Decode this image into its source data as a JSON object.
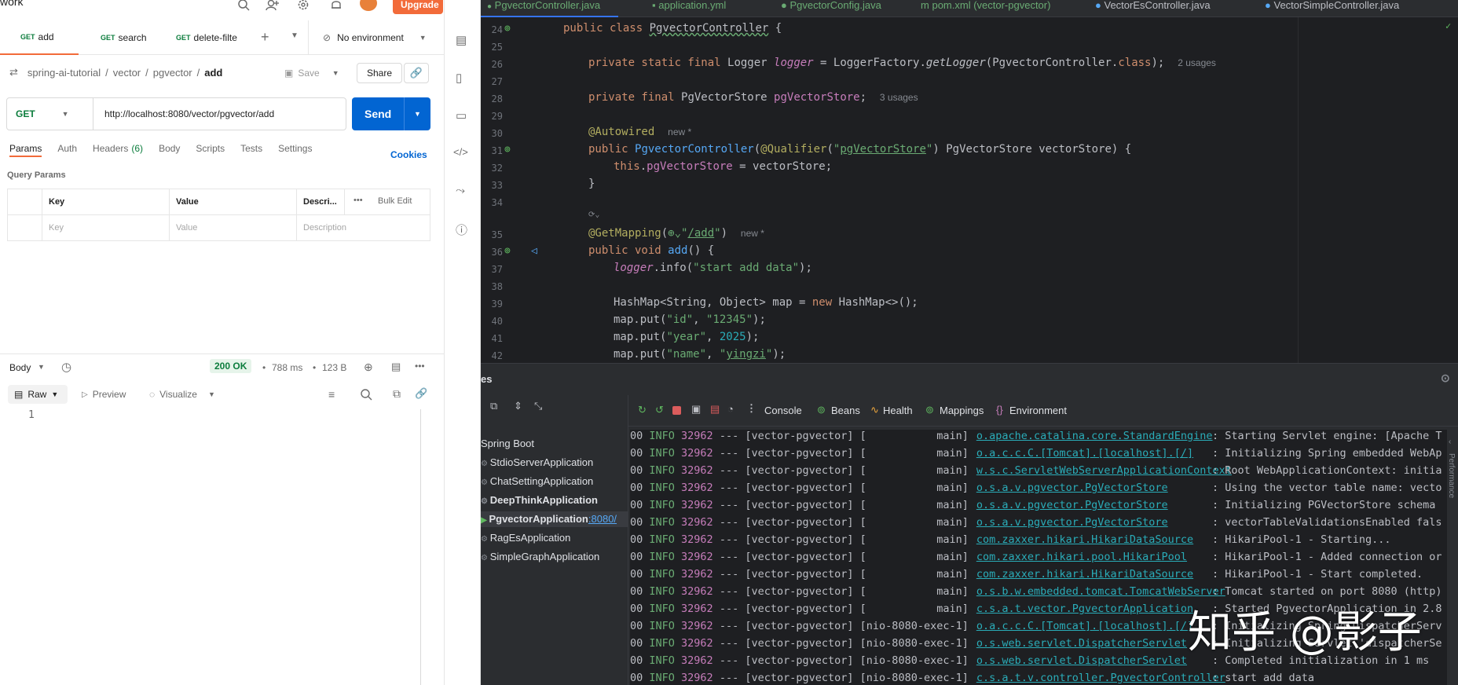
{
  "postman": {
    "workspace_label": "work",
    "upgrade_label": "Upgrade",
    "tabs": [
      {
        "method": "GET",
        "label": "add"
      },
      {
        "method": "GET",
        "label": "search"
      },
      {
        "method": "GET",
        "label": "delete-filte"
      }
    ],
    "environment": "No environment",
    "breadcrumb": [
      "spring-ai-tutorial",
      "vector",
      "pgvector",
      "add"
    ],
    "save_label": "Save",
    "share_label": "Share",
    "request": {
      "method": "GET",
      "url": "http://localhost:8080/vector/pgvector/add",
      "send_label": "Send"
    },
    "subtabs": [
      "Params",
      "Auth",
      "Headers",
      "(6)",
      "Body",
      "Scripts",
      "Tests",
      "Settings"
    ],
    "cookies_label": "Cookies",
    "query_params_label": "Query Params",
    "table_headers": [
      "Key",
      "Value",
      "Descri...",
      "Bulk Edit"
    ],
    "table_placeholder": [
      "Key",
      "Value",
      "Description"
    ],
    "response": {
      "body_label": "Body",
      "status": "200 OK",
      "time": "788 ms",
      "size": "123 B",
      "raw_label": "Raw",
      "preview_label": "Preview",
      "visualize_label": "Visualize",
      "line_number": "1"
    }
  },
  "ide": {
    "file_tabs": [
      "PgvectorController.java",
      "application.yml",
      "PgvectorConfig.java",
      "pom.xml (vector-pgvector)",
      "VectorEsController.java",
      "VectorSimpleController.java"
    ],
    "line_numbers": [
      "24",
      "25",
      "26",
      "27",
      "28",
      "29",
      "30",
      "31",
      "32",
      "33",
      "34",
      "",
      "35",
      "36",
      "37",
      "38",
      "39",
      "40",
      "41",
      "42"
    ],
    "hints": {
      "usages_2": "2 usages",
      "usages_3": "3 usages",
      "new": "new *"
    },
    "services": {
      "title": "es",
      "root": "Spring Boot",
      "apps": [
        "StdioServerApplication",
        "ChatSettingApplication",
        "DeepThinkApplication",
        "PgvectorApplication",
        "RagEsApplication",
        "SimpleGraphApplication"
      ],
      "port_label": ":8080/",
      "tabs": [
        "Console",
        "Beans",
        "Health",
        "Mappings",
        "Environment"
      ],
      "side_label": "Performance"
    },
    "log_rows": [
      {
        "level": "INFO",
        "pid": "32962",
        "sep": "---",
        "app": "[vector-pgvector]",
        "thread": "[           main]",
        "logger": "o.apache.catalina.core.StandardEngine",
        "msg": ": Starting Servlet engine: [Apache T"
      },
      {
        "level": "INFO",
        "pid": "32962",
        "sep": "---",
        "app": "[vector-pgvector]",
        "thread": "[           main]",
        "logger": "o.a.c.c.C.[Tomcat].[localhost].[/]",
        "msg": ": Initializing Spring embedded WebAp"
      },
      {
        "level": "INFO",
        "pid": "32962",
        "sep": "---",
        "app": "[vector-pgvector]",
        "thread": "[           main]",
        "logger": "w.s.c.ServletWebServerApplicationContext",
        "msg": ": Root WebApplicationContext: initia"
      },
      {
        "level": "INFO",
        "pid": "32962",
        "sep": "---",
        "app": "[vector-pgvector]",
        "thread": "[           main]",
        "logger": "o.s.a.v.pgvector.PgVectorStore",
        "msg": ": Using the vector table name: vecto"
      },
      {
        "level": "INFO",
        "pid": "32962",
        "sep": "---",
        "app": "[vector-pgvector]",
        "thread": "[           main]",
        "logger": "o.s.a.v.pgvector.PgVectorStore",
        "msg": ": Initializing PGVectorStore schema"
      },
      {
        "level": "INFO",
        "pid": "32962",
        "sep": "---",
        "app": "[vector-pgvector]",
        "thread": "[           main]",
        "logger": "o.s.a.v.pgvector.PgVectorStore",
        "msg": ": vectorTableValidationsEnabled fals"
      },
      {
        "level": "INFO",
        "pid": "32962",
        "sep": "---",
        "app": "[vector-pgvector]",
        "thread": "[           main]",
        "logger": "com.zaxxer.hikari.HikariDataSource",
        "msg": ": HikariPool-1 - Starting..."
      },
      {
        "level": "INFO",
        "pid": "32962",
        "sep": "---",
        "app": "[vector-pgvector]",
        "thread": "[           main]",
        "logger": "com.zaxxer.hikari.pool.HikariPool",
        "msg": ": HikariPool-1 - Added connection or"
      },
      {
        "level": "INFO",
        "pid": "32962",
        "sep": "---",
        "app": "[vector-pgvector]",
        "thread": "[           main]",
        "logger": "com.zaxxer.hikari.HikariDataSource",
        "msg": ": HikariPool-1 - Start completed."
      },
      {
        "level": "INFO",
        "pid": "32962",
        "sep": "---",
        "app": "[vector-pgvector]",
        "thread": "[           main]",
        "logger": "o.s.b.w.embedded.tomcat.TomcatWebServer",
        "msg": ": Tomcat started on port 8080 (http)"
      },
      {
        "level": "INFO",
        "pid": "32962",
        "sep": "---",
        "app": "[vector-pgvector]",
        "thread": "[           main]",
        "logger": "c.s.a.t.vector.PgvectorApplication",
        "msg": ": Started PgvectorApplication in 2.8"
      },
      {
        "level": "INFO",
        "pid": "32962",
        "sep": "---",
        "app": "[vector-pgvector]",
        "thread": "[nio-8080-exec-1]",
        "logger": "o.a.c.c.C.[Tomcat].[localhost].[/]",
        "msg": ": Initializing Spring DispatcherServ"
      },
      {
        "level": "INFO",
        "pid": "32962",
        "sep": "---",
        "app": "[vector-pgvector]",
        "thread": "[nio-8080-exec-1]",
        "logger": "o.s.web.servlet.DispatcherServlet",
        "msg": ": Initializing Servlet 'dispatcherSe"
      },
      {
        "level": "INFO",
        "pid": "32962",
        "sep": "---",
        "app": "[vector-pgvector]",
        "thread": "[nio-8080-exec-1]",
        "logger": "o.s.web.servlet.DispatcherServlet",
        "msg": ": Completed initialization in 1 ms"
      },
      {
        "level": "INFO",
        "pid": "32962",
        "sep": "---",
        "app": "[vector-pgvector]",
        "thread": "[nio-8080-exec-1]",
        "logger": "c.s.a.t.v.controller.PgvectorController",
        "msg": ": start add data"
      }
    ],
    "watermark": "知乎 @影子"
  }
}
